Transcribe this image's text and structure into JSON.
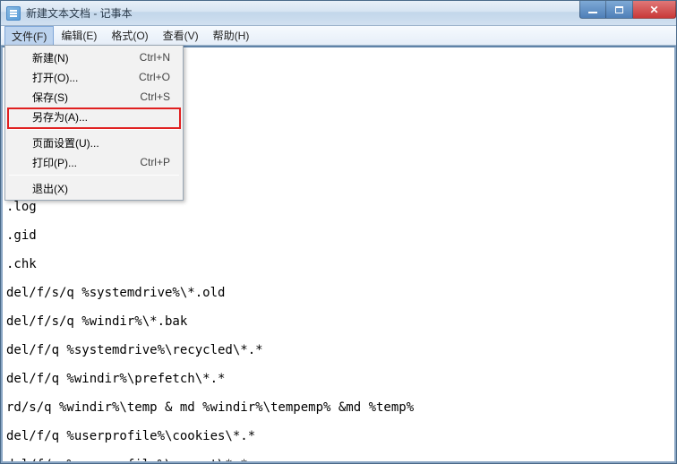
{
  "titlebar": {
    "title": "新建文本文档 - 记事本"
  },
  "menubar": {
    "file": "文件(F)",
    "edit": "编辑(E)",
    "format": "格式(O)",
    "view": "查看(V)",
    "help": "帮助(H)"
  },
  "file_menu": {
    "new": {
      "label": "新建(N)",
      "accel": "Ctrl+N"
    },
    "open": {
      "label": "打开(O)...",
      "accel": "Ctrl+O"
    },
    "save": {
      "label": "保存(S)",
      "accel": "Ctrl+S"
    },
    "save_as": {
      "label": "另存为(A)...",
      "accel": ""
    },
    "page_setup": {
      "label": "页面设置(U)...",
      "accel": ""
    },
    "print": {
      "label": "打印(P)...",
      "accel": "Ctrl+P"
    },
    "exit": {
      "label": "退出(X)",
      "accel": ""
    }
  },
  "editor": {
    "content": "\n\n.tmp\n._mp\n\n.log\n.gid\n.chk\ndel/f/s/q %systemdrive%\\*.old\ndel/f/s/q %windir%\\*.bak\ndel/f/q %systemdrive%\\recycled\\*.*\ndel/f/q %windir%\\prefetch\\*.*\nrd/s/q %windir%\\temp & md %windir%\\tempemp% &md %temp%\ndel/f/q %userprofile%\\cookies\\*.*\ndel/f/q %userprofile%\\recent\\*.*\nrd/s/q \\ \"%userprofile%\\Local Settings\\Temporary Internet Files\\\""
  }
}
